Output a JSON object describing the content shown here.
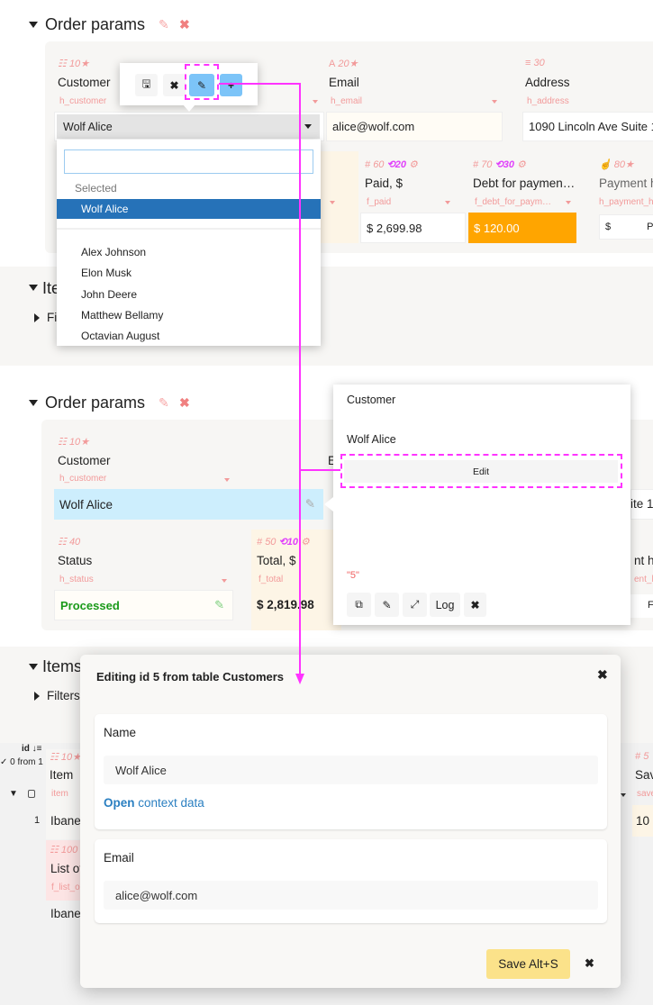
{
  "colors": {
    "accent_magenta": "#ff33ff",
    "selected_blue": "#2672b8",
    "debt_orange": "#ffa500",
    "status_green": "#1a9a1a",
    "link_blue": "#2a7fc1",
    "save_yellow": "#fbe28a",
    "active_cell": "#cdeefd"
  },
  "section1": {
    "title": "Order params",
    "fields": {
      "customer": {
        "meta_num": "10",
        "label": "Customer",
        "sub": "h_customer",
        "value": "Wolf Alice"
      },
      "email": {
        "meta_num": "20",
        "label": "Email",
        "sub": "h_email",
        "value": "alice@wolf.com"
      },
      "address": {
        "meta_num": "30",
        "label": "Address",
        "sub": "h_address",
        "value": "1090 Lincoln Ave Suite 1"
      },
      "paid": {
        "meta_num": "60",
        "meta_extra": "20",
        "label": "Paid, $",
        "sub": "f_paid",
        "value": "$ 2,699.98"
      },
      "debt": {
        "meta_num": "70",
        "meta_extra": "30",
        "label": "Debt for paymen…",
        "sub": "f_debt_for_paym…",
        "value": "$ 120.00"
      },
      "payment": {
        "meta_num": "80",
        "label": "Payment h",
        "sub": "h_payment_h",
        "value": "$",
        "value2": "P"
      }
    },
    "dropdown": {
      "search_value": "",
      "group_label": "Selected",
      "selected": "Wolf Alice",
      "options": [
        "Alex Johnson",
        "Elon Musk",
        "John Deere",
        "Matthew Bellamy",
        "Octavian August"
      ]
    }
  },
  "section2": {
    "title": "Ite",
    "filters": "Fi"
  },
  "section3": {
    "title": "Order params",
    "customer": {
      "meta_num": "10",
      "label": "Customer",
      "sub": "h_customer",
      "value": "Wolf Alice"
    },
    "email_partial": "E",
    "status": {
      "meta_num": "40",
      "label": "Status",
      "sub": "h_status",
      "value": "Processed"
    },
    "total": {
      "meta_num": "50",
      "meta_extra": "10",
      "label": "Total, $",
      "sub": "f_total",
      "value": "$ 2,819.98"
    },
    "right_partials": {
      "address": "ite 1",
      "label": "nt h",
      "sub": "ent_h",
      "value": "F"
    },
    "popover": {
      "title": "Customer",
      "value": "Wolf Alice",
      "edit_label": "Edit",
      "id_text": "\"5\"",
      "log_label": "Log"
    }
  },
  "section4": {
    "title": "Items",
    "filters": "Filters",
    "table": {
      "id_header": "id",
      "selection_count": "✓ 0 from 1",
      "item_meta": "10",
      "item_label": "Item",
      "item_sub": "item",
      "row_id": "1",
      "row_item": "Ibanez",
      "list_meta": "100",
      "list_label": "List of",
      "list_sub": "f_list_o",
      "row2_item": "Ibanez",
      "right_meta": "5",
      "right_label": "Sav",
      "right_sub": "save",
      "right_value": "10"
    }
  },
  "modal": {
    "title": "Editing id 5 from table Customers",
    "name_label": "Name",
    "name_value": "Wolf Alice",
    "link_bold": "Open",
    "link_rest": " context data",
    "email_label": "Email",
    "email_value": "alice@wolf.com",
    "save_label": "Save Alt+S"
  }
}
